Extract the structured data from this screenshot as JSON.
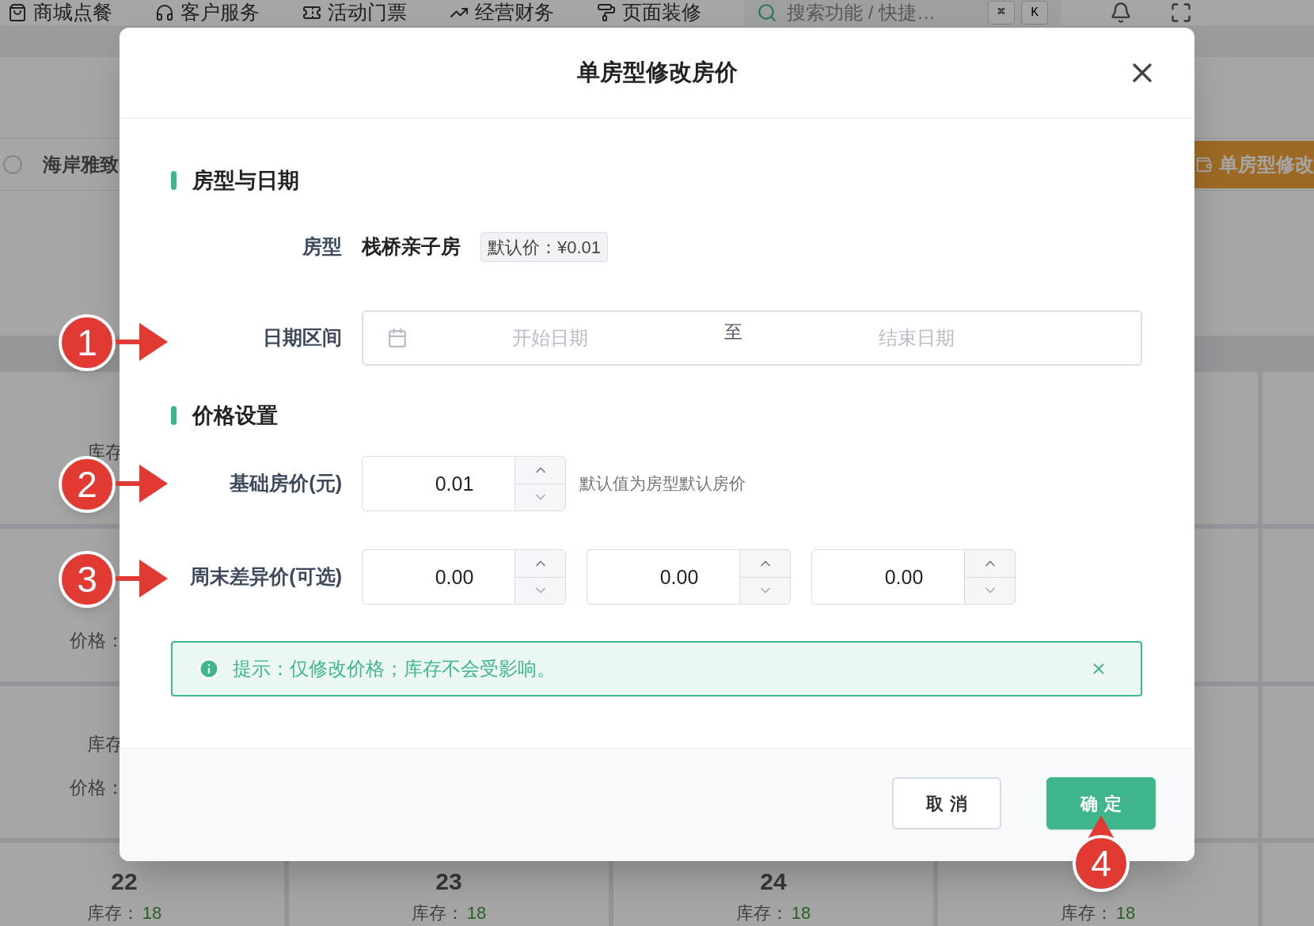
{
  "background": {
    "nav": [
      {
        "label": "商城点餐"
      },
      {
        "label": "客户服务"
      },
      {
        "label": "活动门票"
      },
      {
        "label": "经营财务"
      },
      {
        "label": "页面装修"
      }
    ],
    "search": {
      "placeholder": "搜索功能 / 快捷…"
    },
    "shortcut_keys": [
      "⌘",
      "K"
    ],
    "toolbar": {
      "hotel": "海岸雅致",
      "action_button": "单房型修改"
    },
    "calendar": {
      "partial_cells": [
        {
          "lines": [
            {
              "kind": "stock",
              "text": "库存"
            }
          ]
        },
        {
          "lines": [
            {
              "kind": "price",
              "text": "价格："
            }
          ]
        },
        {
          "lines": [
            {
              "kind": "stock",
              "text": "库存"
            },
            {
              "kind": "price",
              "text": "价格："
            }
          ]
        }
      ],
      "bottom_cells": [
        {
          "date": "22",
          "stock_label": "库存：",
          "stock": "18"
        },
        {
          "date": "23",
          "stock_label": "库存：",
          "stock": "18"
        },
        {
          "date": "24",
          "stock_label": "库存：",
          "stock": "18"
        },
        {
          "stock_label": "库存：",
          "stock": "18"
        }
      ]
    }
  },
  "dialog": {
    "title": "单房型修改房价",
    "room_section": {
      "title": "房型与日期",
      "room_type": {
        "label": "房型",
        "value": "栈桥亲子房",
        "default_price_tag": "默认价：¥0.01"
      },
      "date_range": {
        "label": "日期区间",
        "start_placeholder": "开始日期",
        "separator": "至",
        "end_placeholder": "结束日期"
      }
    },
    "price_section": {
      "title": "价格设置",
      "base_price": {
        "label": "基础房价(元)",
        "value": "0.01",
        "hint": "默认值为房型默认房价"
      },
      "weekend_price": {
        "label": "周末差异价(可选)",
        "values": [
          "0.00",
          "0.00",
          "0.00"
        ]
      }
    },
    "alert": {
      "text": "提示：仅修改价格；库存不会受影响。"
    },
    "buttons": [
      {
        "label": "取消",
        "kind": "secondary"
      },
      {
        "label": "确定",
        "kind": "primary"
      }
    ]
  },
  "annotations": [
    {
      "label": "1"
    },
    {
      "label": "2"
    },
    {
      "label": "3"
    },
    {
      "label": "4"
    }
  ]
}
